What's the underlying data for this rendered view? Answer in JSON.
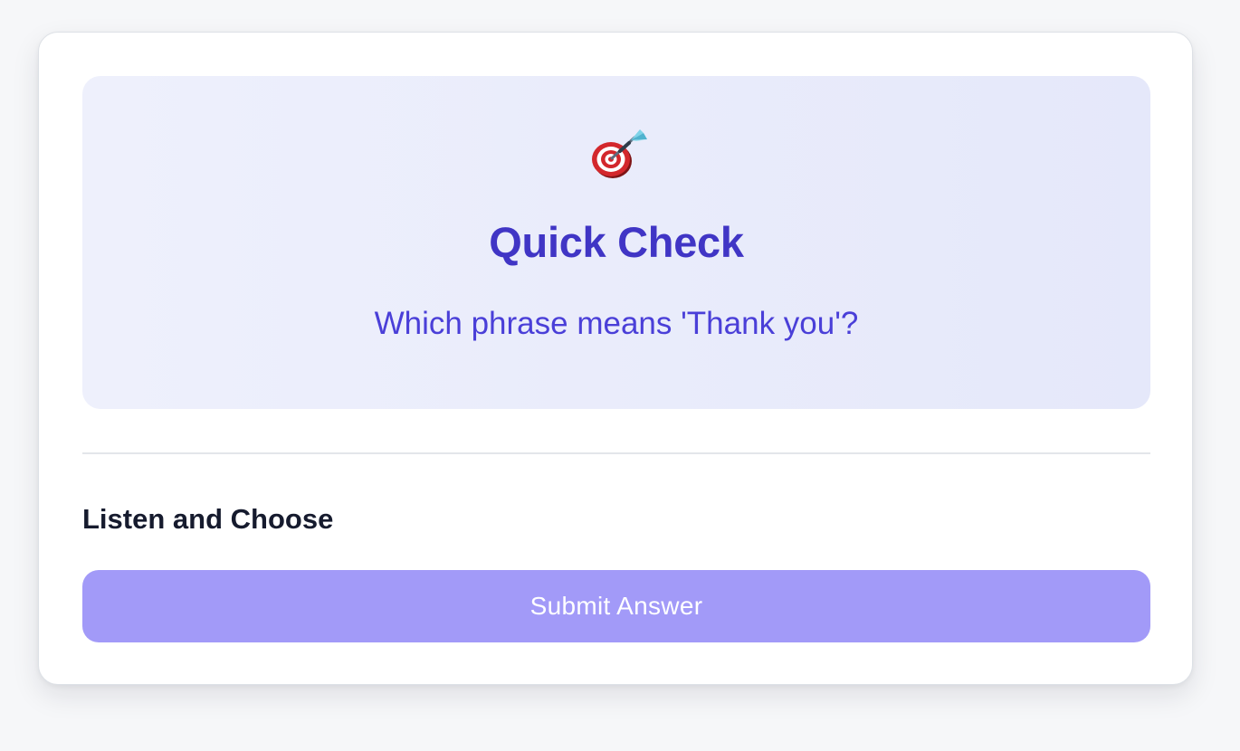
{
  "quiz": {
    "icon": "dart-target-icon",
    "title": "Quick Check",
    "question": "Which phrase means 'Thank you'?",
    "section_label": "Listen and Choose",
    "submit_label": "Submit Answer"
  },
  "colors": {
    "page_background": "#f6f7f9",
    "card_background": "#ffffff",
    "hero_background": "#eceefc",
    "title_color": "#4035c5",
    "question_color": "#4a3fd8",
    "label_color": "#161b2e",
    "button_background": "#a29af8",
    "button_text": "#ffffff"
  }
}
